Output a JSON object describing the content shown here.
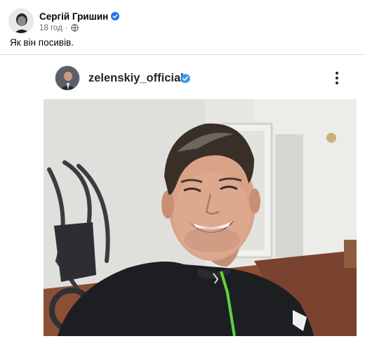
{
  "post": {
    "author": "Сергій Гришин",
    "time": "18 год",
    "separator": "·",
    "text": "Як він посивів."
  },
  "embed": {
    "username": "zelenskiy_official"
  },
  "icons": {
    "author_verified": "verified-badge-icon",
    "privacy": "globe-icon",
    "ig_verified": "verified-badge-icon",
    "more": "more-vertical-icon"
  },
  "colors": {
    "facebook_blue": "#1877f2",
    "instagram_blue": "#3897f0",
    "secondary_text": "#65676b",
    "shirt_stripe": "#5fd33e"
  }
}
